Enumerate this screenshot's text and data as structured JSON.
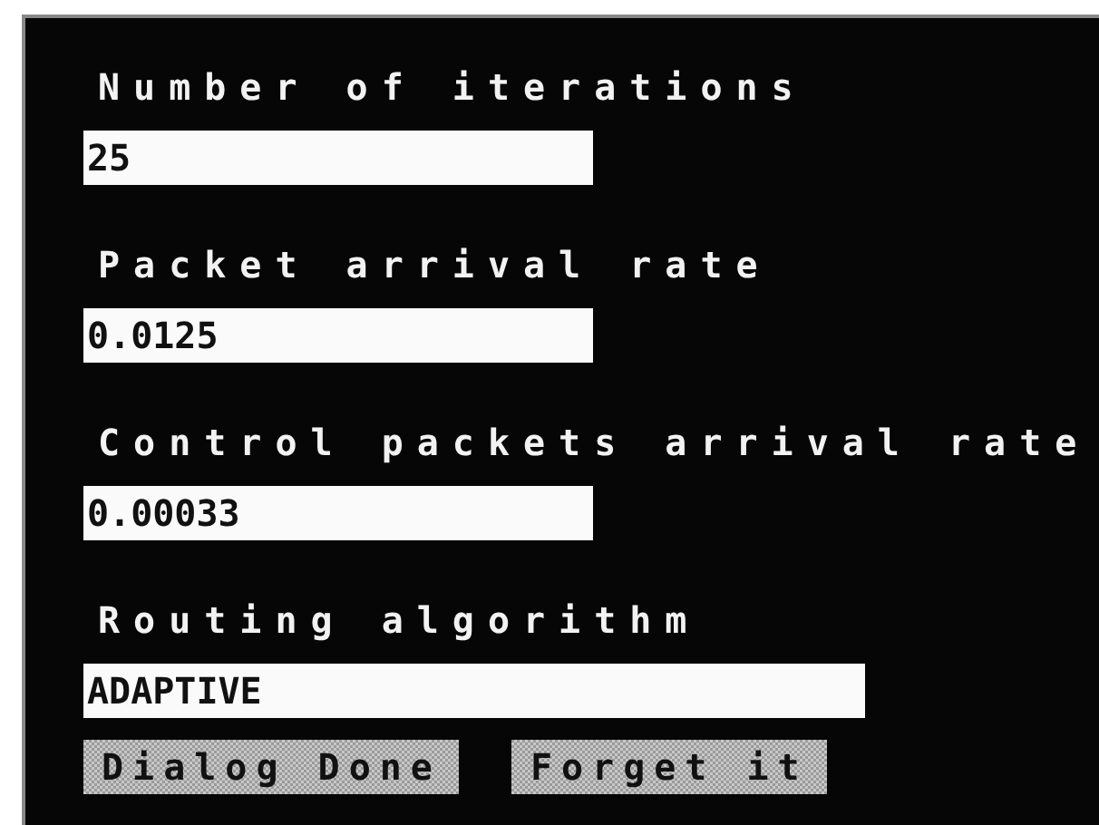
{
  "fields": [
    {
      "label": "Number of iterations",
      "value": "25",
      "kind": "number"
    },
    {
      "label": "Packet arrival rate",
      "value": "0.0125",
      "kind": "number"
    },
    {
      "label": "Control packets arrival rate",
      "value": "0.00033",
      "kind": "number"
    },
    {
      "label": "Routing algorithm",
      "value": "ADAPTIVE",
      "kind": "text"
    }
  ],
  "buttons": [
    "Dialog Done",
    "Forget it"
  ]
}
